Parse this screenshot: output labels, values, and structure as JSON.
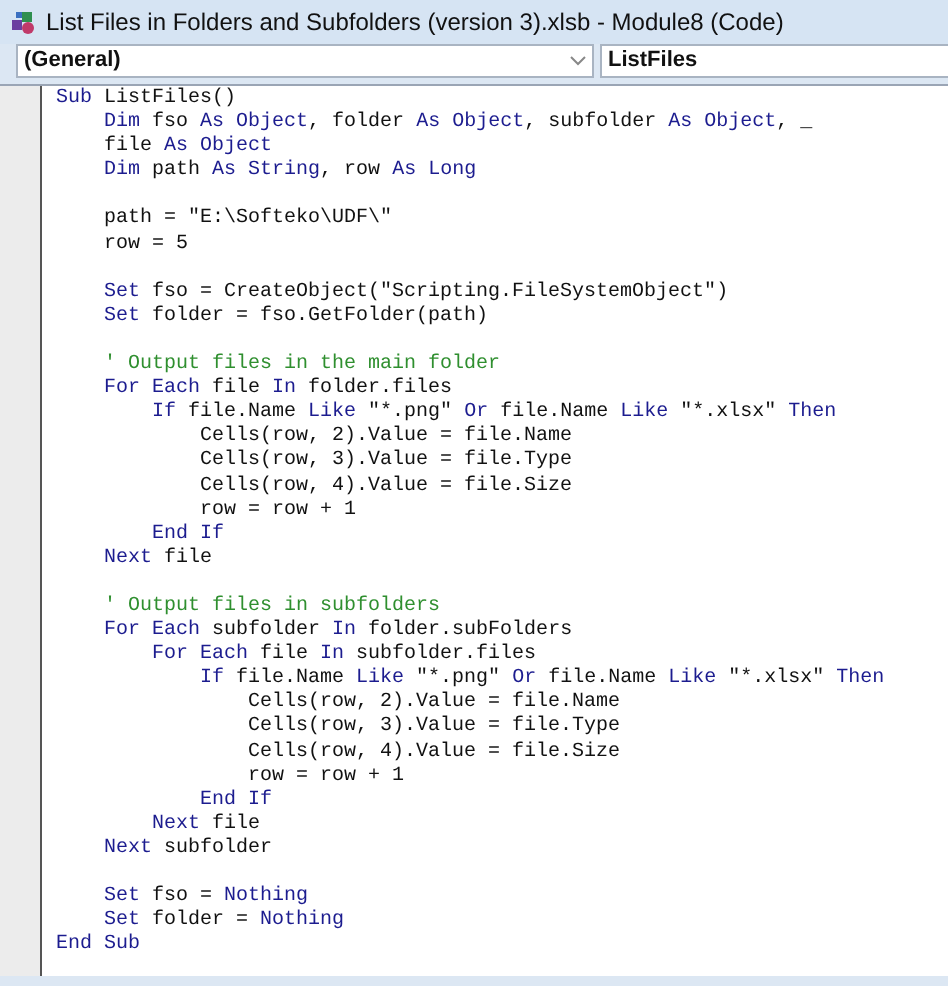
{
  "window": {
    "title": "List Files in Folders and Subfolders (version 3).xlsb - Module8 (Code)"
  },
  "object_dropdown": {
    "value": "(General)"
  },
  "procedure_dropdown": {
    "value": "ListFiles"
  },
  "code_blocks": [
    [
      [
        {
          "kind": "keyword",
          "text": "Sub"
        },
        {
          "kind": "plain",
          "text": " ListFiles()"
        }
      ],
      [
        {
          "kind": "keyword",
          "text": "    Dim"
        },
        {
          "kind": "plain",
          "text": " fso "
        },
        {
          "kind": "keyword",
          "text": "As Object"
        },
        {
          "kind": "plain",
          "text": ", folder "
        },
        {
          "kind": "keyword",
          "text": "As Object"
        },
        {
          "kind": "plain",
          "text": ", subfolder "
        },
        {
          "kind": "keyword",
          "text": "As Object"
        },
        {
          "kind": "plain",
          "text": ", _"
        }
      ],
      [
        {
          "kind": "plain",
          "text": "    file "
        },
        {
          "kind": "keyword",
          "text": "As Object"
        }
      ],
      [
        {
          "kind": "keyword",
          "text": "    Dim"
        },
        {
          "kind": "plain",
          "text": " path "
        },
        {
          "kind": "keyword",
          "text": "As String"
        },
        {
          "kind": "plain",
          "text": ", row "
        },
        {
          "kind": "keyword",
          "text": "As Long"
        }
      ]
    ],
    [
      [
        {
          "kind": "plain",
          "text": "    path = \"E:\\Softeko\\UDF\\\""
        }
      ],
      [
        {
          "kind": "plain",
          "text": "    row = 5"
        }
      ]
    ],
    [
      [
        {
          "kind": "keyword",
          "text": "    Set"
        },
        {
          "kind": "plain",
          "text": " fso = CreateObject(\"Scripting.FileSystemObject\")"
        }
      ],
      [
        {
          "kind": "keyword",
          "text": "    Set"
        },
        {
          "kind": "plain",
          "text": " folder = fso.GetFolder(path)"
        }
      ]
    ],
    [
      [
        {
          "kind": "comment",
          "text": "    ' Output files in the main folder"
        }
      ],
      [
        {
          "kind": "keyword",
          "text": "    For Each"
        },
        {
          "kind": "plain",
          "text": " file "
        },
        {
          "kind": "keyword",
          "text": "In"
        },
        {
          "kind": "plain",
          "text": " folder.files"
        }
      ],
      [
        {
          "kind": "keyword",
          "text": "        If"
        },
        {
          "kind": "plain",
          "text": " file.Name "
        },
        {
          "kind": "keyword",
          "text": "Like"
        },
        {
          "kind": "plain",
          "text": " \"*.png\" "
        },
        {
          "kind": "keyword",
          "text": "Or"
        },
        {
          "kind": "plain",
          "text": " file.Name "
        },
        {
          "kind": "keyword",
          "text": "Like"
        },
        {
          "kind": "plain",
          "text": " \"*.xlsx\" "
        },
        {
          "kind": "keyword",
          "text": "Then"
        }
      ],
      [
        {
          "kind": "plain",
          "text": "            Cells(row, 2).Value = file.Name"
        }
      ],
      [
        {
          "kind": "plain",
          "text": "            Cells(row, 3).Value = file.Type"
        }
      ],
      [
        {
          "kind": "plain",
          "text": "            Cells(row, 4).Value = file.Size"
        }
      ],
      [
        {
          "kind": "plain",
          "text": "            row = row + 1"
        }
      ],
      [
        {
          "kind": "keyword",
          "text": "        End If"
        }
      ],
      [
        {
          "kind": "keyword",
          "text": "    Next"
        },
        {
          "kind": "plain",
          "text": " file"
        }
      ]
    ],
    [
      [
        {
          "kind": "comment",
          "text": "    ' Output files in subfolders"
        }
      ],
      [
        {
          "kind": "keyword",
          "text": "    For Each"
        },
        {
          "kind": "plain",
          "text": " subfolder "
        },
        {
          "kind": "keyword",
          "text": "In"
        },
        {
          "kind": "plain",
          "text": " folder.subFolders"
        }
      ],
      [
        {
          "kind": "keyword",
          "text": "        For Each"
        },
        {
          "kind": "plain",
          "text": " file "
        },
        {
          "kind": "keyword",
          "text": "In"
        },
        {
          "kind": "plain",
          "text": " subfolder.files"
        }
      ],
      [
        {
          "kind": "keyword",
          "text": "            If"
        },
        {
          "kind": "plain",
          "text": " file.Name "
        },
        {
          "kind": "keyword",
          "text": "Like"
        },
        {
          "kind": "plain",
          "text": " \"*.png\" "
        },
        {
          "kind": "keyword",
          "text": "Or"
        },
        {
          "kind": "plain",
          "text": " file.Name "
        },
        {
          "kind": "keyword",
          "text": "Like"
        },
        {
          "kind": "plain",
          "text": " \"*.xlsx\" "
        },
        {
          "kind": "keyword",
          "text": "Then"
        }
      ],
      [
        {
          "kind": "plain",
          "text": "                Cells(row, 2).Value = file.Name"
        }
      ],
      [
        {
          "kind": "plain",
          "text": "                Cells(row, 3).Value = file.Type"
        }
      ],
      [
        {
          "kind": "plain",
          "text": "                Cells(row, 4).Value = file.Size"
        }
      ],
      [
        {
          "kind": "plain",
          "text": "                row = row + 1"
        }
      ],
      [
        {
          "kind": "keyword",
          "text": "            End If"
        }
      ],
      [
        {
          "kind": "keyword",
          "text": "        Next"
        },
        {
          "kind": "plain",
          "text": " file"
        }
      ],
      [
        {
          "kind": "keyword",
          "text": "    Next"
        },
        {
          "kind": "plain",
          "text": " subfolder"
        }
      ]
    ],
    [
      [
        {
          "kind": "keyword",
          "text": "    Set"
        },
        {
          "kind": "plain",
          "text": " fso = "
        },
        {
          "kind": "keyword",
          "text": "Nothing"
        }
      ],
      [
        {
          "kind": "keyword",
          "text": "    Set"
        },
        {
          "kind": "plain",
          "text": " folder = "
        },
        {
          "kind": "keyword",
          "text": "Nothing"
        }
      ],
      [
        {
          "kind": "keyword",
          "text": "End Sub"
        }
      ]
    ]
  ]
}
